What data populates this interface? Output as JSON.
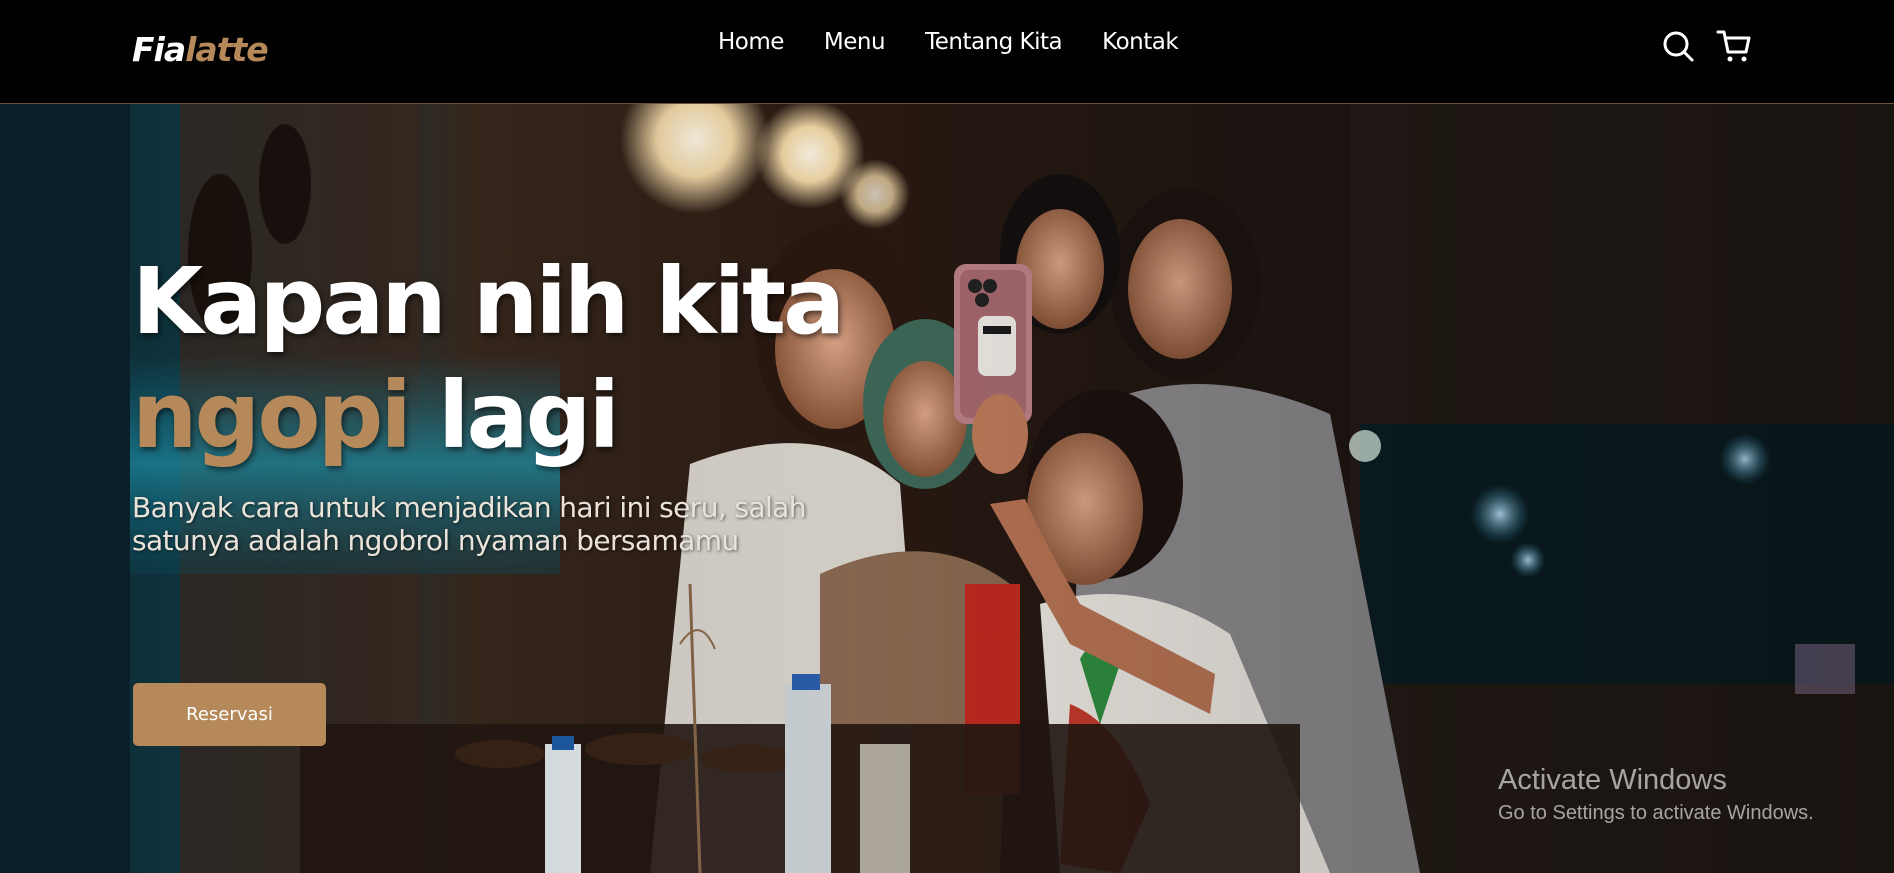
{
  "brand": {
    "logo_part1": "Fia",
    "logo_part2": "latte"
  },
  "nav": {
    "links": [
      {
        "label": "Home"
      },
      {
        "label": "Menu"
      },
      {
        "label": "Tentang Kita"
      },
      {
        "label": "Kontak"
      }
    ]
  },
  "icons": {
    "search": "search-icon",
    "cart": "shopping-cart-icon"
  },
  "hero": {
    "title_line1": "Kapan nih kita",
    "title_accent": "ngopi",
    "title_line2_rest": " lagi",
    "subtitle": "Banyak cara untuk menjadikan hari ini seru, salah satunya adalah ngobrol nyaman bersamamu",
    "cta_label": "Reservasi"
  },
  "watermark": {
    "title": "Activate Windows",
    "subtitle": "Go to Settings to activate Windows."
  },
  "colors": {
    "accent": "#b6895b",
    "navbar_bg": "#010101",
    "text": "#ffffff"
  }
}
